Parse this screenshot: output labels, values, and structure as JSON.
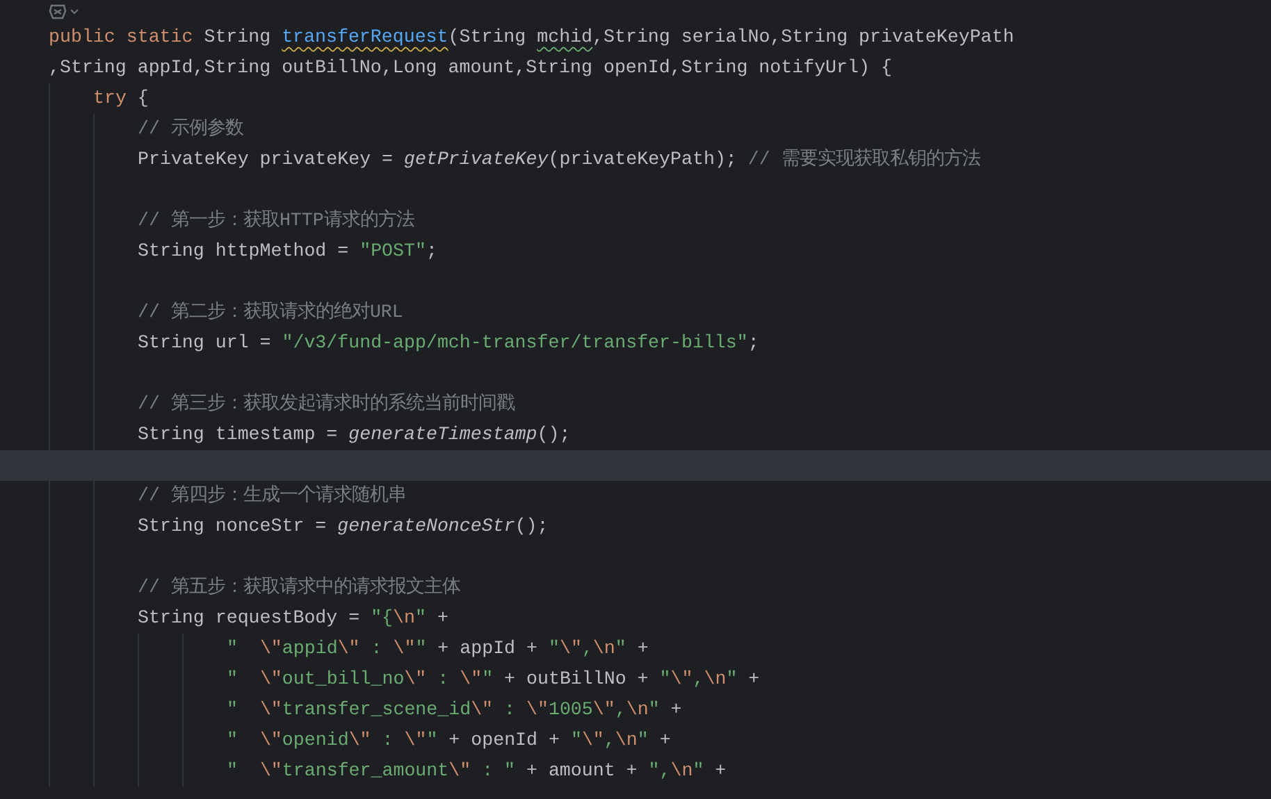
{
  "editor": {
    "lines": [
      {
        "kind": "code",
        "current": false,
        "tokens": [
          {
            "kind": "keyword",
            "text": "public static "
          },
          {
            "kind": "text",
            "text": "String "
          },
          {
            "kind": "flagged",
            "text": "transferRequest"
          },
          {
            "kind": "text",
            "text": "(String "
          },
          {
            "kind": "misspelled",
            "text": "mchid"
          },
          {
            "kind": "text",
            "text": ",String serialNo,String privateKeyPath"
          }
        ]
      },
      {
        "kind": "code",
        "current": false,
        "tokens": [
          {
            "kind": "text",
            "text": ",String appId,String outBillNo,Long amount,String openId,String notifyUrl) {"
          }
        ],
        "children": [
          {
            "kind": "code",
            "current": false,
            "tokens": [
              {
                "kind": "keyword",
                "text": "try"
              },
              {
                "kind": "text",
                "text": " {"
              }
            ],
            "children": [
              {
                "kind": "code",
                "current": false,
                "tokens": [
                  {
                    "kind": "comment",
                    "text": "// 示例参数"
                  }
                ]
              },
              {
                "kind": "code",
                "current": false,
                "tokens": [
                  {
                    "kind": "text",
                    "text": "PrivateKey privateKey = "
                  },
                  {
                    "kind": "call",
                    "text": "getPrivateKey"
                  },
                  {
                    "kind": "text",
                    "text": "(privateKeyPath); "
                  },
                  {
                    "kind": "comment",
                    "text": "// 需要实现获取私钥的方法"
                  }
                ]
              },
              {
                "kind": "blank",
                "current": false
              },
              {
                "kind": "code",
                "current": false,
                "tokens": [
                  {
                    "kind": "comment",
                    "text": "// 第一步：获取HTTP请求的方法"
                  }
                ]
              },
              {
                "kind": "code",
                "current": false,
                "tokens": [
                  {
                    "kind": "text",
                    "text": "String httpMethod = "
                  },
                  {
                    "kind": "string",
                    "text": "\"POST\""
                  },
                  {
                    "kind": "text",
                    "text": ";"
                  }
                ]
              },
              {
                "kind": "blank",
                "current": false
              },
              {
                "kind": "code",
                "current": false,
                "tokens": [
                  {
                    "kind": "comment",
                    "text": "// 第二步：获取请求的绝对URL"
                  }
                ]
              },
              {
                "kind": "code",
                "current": false,
                "tokens": [
                  {
                    "kind": "text",
                    "text": "String url = "
                  },
                  {
                    "kind": "string",
                    "text": "\"/v3/fund-app/mch-transfer/transfer-bills\""
                  },
                  {
                    "kind": "text",
                    "text": ";"
                  }
                ]
              },
              {
                "kind": "blank",
                "current": false
              },
              {
                "kind": "code",
                "current": false,
                "tokens": [
                  {
                    "kind": "comment",
                    "text": "// 第三步：获取发起请求时的系统当前时间戳"
                  }
                ]
              },
              {
                "kind": "code",
                "current": false,
                "tokens": [
                  {
                    "kind": "text",
                    "text": "String timestamp = "
                  },
                  {
                    "kind": "call",
                    "text": "generateTimestamp"
                  },
                  {
                    "kind": "text",
                    "text": "();"
                  }
                ]
              },
              {
                "kind": "blank",
                "current": true
              },
              {
                "kind": "code",
                "current": false,
                "tokens": [
                  {
                    "kind": "comment",
                    "text": "// 第四步：生成一个请求随机串"
                  }
                ]
              },
              {
                "kind": "code",
                "current": false,
                "tokens": [
                  {
                    "kind": "text",
                    "text": "String nonceStr = "
                  },
                  {
                    "kind": "call",
                    "text": "generateNonceStr"
                  },
                  {
                    "kind": "text",
                    "text": "();"
                  }
                ]
              },
              {
                "kind": "blank",
                "current": false
              },
              {
                "kind": "code",
                "current": false,
                "tokens": [
                  {
                    "kind": "comment",
                    "text": "// 第五步：获取请求中的请求报文主体"
                  }
                ]
              },
              {
                "kind": "code",
                "current": false,
                "tokens": [
                  {
                    "kind": "text",
                    "text": "String requestBody = "
                  },
                  {
                    "kind": "string",
                    "text": "\"{"
                  },
                  {
                    "kind": "escape",
                    "text": "\\n"
                  },
                  {
                    "kind": "string",
                    "text": "\""
                  },
                  {
                    "kind": "text",
                    "text": " +"
                  }
                ],
                "children": [
                  {
                    "kind": "continuation",
                    "current": false,
                    "tokens": [
                      {
                        "kind": "string",
                        "text": "\"  "
                      },
                      {
                        "kind": "escape",
                        "text": "\\\""
                      },
                      {
                        "kind": "string",
                        "text": "appid"
                      },
                      {
                        "kind": "escape",
                        "text": "\\\""
                      },
                      {
                        "kind": "string",
                        "text": " : "
                      },
                      {
                        "kind": "escape",
                        "text": "\\\""
                      },
                      {
                        "kind": "string",
                        "text": "\""
                      },
                      {
                        "kind": "text",
                        "text": " + appId + "
                      },
                      {
                        "kind": "string",
                        "text": "\""
                      },
                      {
                        "kind": "escape",
                        "text": "\\\""
                      },
                      {
                        "kind": "string",
                        "text": ","
                      },
                      {
                        "kind": "escape",
                        "text": "\\n"
                      },
                      {
                        "kind": "string",
                        "text": "\""
                      },
                      {
                        "kind": "text",
                        "text": " +"
                      }
                    ]
                  },
                  {
                    "kind": "continuation",
                    "current": false,
                    "tokens": [
                      {
                        "kind": "string",
                        "text": "\"  "
                      },
                      {
                        "kind": "escape",
                        "text": "\\\""
                      },
                      {
                        "kind": "string",
                        "text": "out_bill_no"
                      },
                      {
                        "kind": "escape",
                        "text": "\\\""
                      },
                      {
                        "kind": "string",
                        "text": " : "
                      },
                      {
                        "kind": "escape",
                        "text": "\\\""
                      },
                      {
                        "kind": "string",
                        "text": "\""
                      },
                      {
                        "kind": "text",
                        "text": " + outBillNo + "
                      },
                      {
                        "kind": "string",
                        "text": "\""
                      },
                      {
                        "kind": "escape",
                        "text": "\\\""
                      },
                      {
                        "kind": "string",
                        "text": ","
                      },
                      {
                        "kind": "escape",
                        "text": "\\n"
                      },
                      {
                        "kind": "string",
                        "text": "\""
                      },
                      {
                        "kind": "text",
                        "text": " +"
                      }
                    ]
                  },
                  {
                    "kind": "continuation",
                    "current": false,
                    "tokens": [
                      {
                        "kind": "string",
                        "text": "\"  "
                      },
                      {
                        "kind": "escape",
                        "text": "\\\""
                      },
                      {
                        "kind": "string",
                        "text": "transfer_scene_id"
                      },
                      {
                        "kind": "escape",
                        "text": "\\\""
                      },
                      {
                        "kind": "string",
                        "text": " : "
                      },
                      {
                        "kind": "escape",
                        "text": "\\\""
                      },
                      {
                        "kind": "string",
                        "text": "1005"
                      },
                      {
                        "kind": "escape",
                        "text": "\\\""
                      },
                      {
                        "kind": "string",
                        "text": ","
                      },
                      {
                        "kind": "escape",
                        "text": "\\n"
                      },
                      {
                        "kind": "string",
                        "text": "\""
                      },
                      {
                        "kind": "text",
                        "text": " +"
                      }
                    ]
                  },
                  {
                    "kind": "continuation",
                    "current": false,
                    "tokens": [
                      {
                        "kind": "string",
                        "text": "\"  "
                      },
                      {
                        "kind": "escape",
                        "text": "\\\""
                      },
                      {
                        "kind": "string",
                        "text": "openid"
                      },
                      {
                        "kind": "escape",
                        "text": "\\\""
                      },
                      {
                        "kind": "string",
                        "text": " : "
                      },
                      {
                        "kind": "escape",
                        "text": "\\\""
                      },
                      {
                        "kind": "string",
                        "text": "\""
                      },
                      {
                        "kind": "text",
                        "text": " + openId + "
                      },
                      {
                        "kind": "string",
                        "text": "\""
                      },
                      {
                        "kind": "escape",
                        "text": "\\\""
                      },
                      {
                        "kind": "string",
                        "text": ","
                      },
                      {
                        "kind": "escape",
                        "text": "\\n"
                      },
                      {
                        "kind": "string",
                        "text": "\""
                      },
                      {
                        "kind": "text",
                        "text": " +"
                      }
                    ]
                  },
                  {
                    "kind": "continuation",
                    "current": false,
                    "tokens": [
                      {
                        "kind": "string",
                        "text": "\"  "
                      },
                      {
                        "kind": "escape",
                        "text": "\\\""
                      },
                      {
                        "kind": "string",
                        "text": "transfer_amount"
                      },
                      {
                        "kind": "escape",
                        "text": "\\\""
                      },
                      {
                        "kind": "string",
                        "text": " : \""
                      },
                      {
                        "kind": "text",
                        "text": " + amount + "
                      },
                      {
                        "kind": "string",
                        "text": "\","
                      },
                      {
                        "kind": "escape",
                        "text": "\\n"
                      },
                      {
                        "kind": "string",
                        "text": "\""
                      },
                      {
                        "kind": "text",
                        "text": " +"
                      }
                    ]
                  }
                ]
              }
            ]
          }
        ]
      }
    ]
  }
}
